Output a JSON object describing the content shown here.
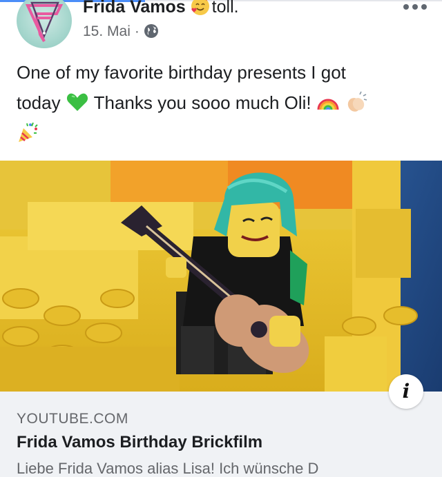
{
  "post": {
    "author": "Frida Vamos",
    "feeling": "toll.",
    "feeling_icon": "smiling-face-with-hearts-icon",
    "date": "15. Mai",
    "separator": "·",
    "privacy_icon": "globe-icon",
    "text_line1": "One of my favorite birthday presents I got",
    "text_line2_a": "today",
    "text_line2_b": "Thanks you sooo much Oli!",
    "inline_emojis": [
      "green-heart-icon",
      "rainbow-icon",
      "clapping-hands-icon",
      "party-popper-icon"
    ]
  },
  "link_preview": {
    "domain": "YOUTUBE.COM",
    "title": "Frida Vamos Birthday Brickfilm",
    "description": "Liebe Frida Vamos alias Lisa! Ich wünsche D",
    "info_label": "i"
  },
  "colors": {
    "top_accent": "#4b8df8",
    "link_background": "#f0f2f5",
    "secondary_text": "#65676b"
  }
}
